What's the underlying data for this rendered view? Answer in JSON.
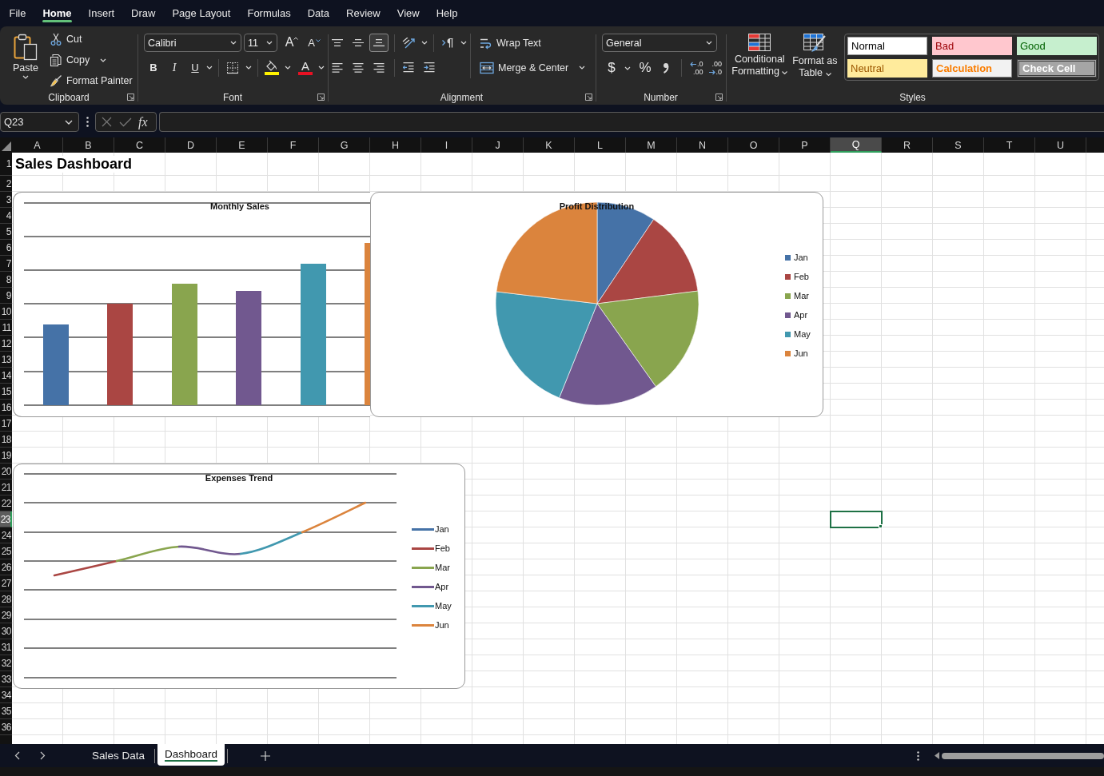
{
  "menu": [
    {
      "label": "File",
      "selected": false
    },
    {
      "label": "Home",
      "selected": true
    },
    {
      "label": "Insert",
      "selected": false
    },
    {
      "label": "Draw",
      "selected": false
    },
    {
      "label": "Page Layout",
      "selected": false
    },
    {
      "label": "Formulas",
      "selected": false
    },
    {
      "label": "Data",
      "selected": false
    },
    {
      "label": "Review",
      "selected": false
    },
    {
      "label": "View",
      "selected": false
    },
    {
      "label": "Help",
      "selected": false
    }
  ],
  "ribbon": {
    "clipboard": {
      "paste": "Paste",
      "cut": "Cut",
      "copy": "Copy",
      "format_painter": "Format Painter",
      "label": "Clipboard"
    },
    "font": {
      "name": "Calibri",
      "size": "11",
      "grow": "A",
      "shrink": "A",
      "bold": "B",
      "italic": "I",
      "underline": "U",
      "font_color": "A",
      "label": "Font"
    },
    "alignment": {
      "vertical": [
        {
          "selected": false
        },
        {
          "selected": false
        },
        {
          "selected": true
        }
      ],
      "wrap_text": "Wrap Text",
      "merge": "Merge & Center",
      "label": "Alignment"
    },
    "number": {
      "format": "General",
      "currency": "$",
      "percent": "%",
      "increase_decimal": {
        "top": ".0",
        "bottom": ".00"
      },
      "decrease_decimal": {
        "top": ".00",
        "bottom": ".0"
      },
      "label": "Number"
    },
    "styles": {
      "conditional_formatting": "Conditional Formatting",
      "format_as_table": "Format as Table",
      "gallery": [
        {
          "label": "Normal",
          "kind": "normal"
        },
        {
          "label": "Bad",
          "kind": "bad"
        },
        {
          "label": "Good",
          "kind": "good"
        },
        {
          "label": "Neutral",
          "kind": "neutral"
        },
        {
          "label": "Calculation",
          "kind": "calculation"
        },
        {
          "label": "Check Cell",
          "kind": "check"
        }
      ],
      "label": "Styles"
    }
  },
  "formula_bar": {
    "name_box": "Q23",
    "function_label": "fx"
  },
  "sheet": {
    "title": "Sales Dashboard",
    "columns": [
      {
        "label": "A",
        "selected": false
      },
      {
        "label": "B",
        "selected": false
      },
      {
        "label": "C",
        "selected": false
      },
      {
        "label": "D",
        "selected": false
      },
      {
        "label": "E",
        "selected": false
      },
      {
        "label": "F",
        "selected": false
      },
      {
        "label": "G",
        "selected": false
      },
      {
        "label": "H",
        "selected": false
      },
      {
        "label": "I",
        "selected": false
      },
      {
        "label": "J",
        "selected": false
      },
      {
        "label": "K",
        "selected": false
      },
      {
        "label": "L",
        "selected": false
      },
      {
        "label": "M",
        "selected": false
      },
      {
        "label": "N",
        "selected": false
      },
      {
        "label": "O",
        "selected": false
      },
      {
        "label": "P",
        "selected": false
      },
      {
        "label": "Q",
        "selected": true
      },
      {
        "label": "R",
        "selected": false
      },
      {
        "label": "S",
        "selected": false
      },
      {
        "label": "T",
        "selected": false
      },
      {
        "label": "U",
        "selected": false
      }
    ],
    "rows": [
      {
        "label": "1",
        "selected": false
      },
      {
        "label": "2",
        "selected": false
      },
      {
        "label": "3",
        "selected": false
      },
      {
        "label": "4",
        "selected": false
      },
      {
        "label": "5",
        "selected": false
      },
      {
        "label": "6",
        "selected": false
      },
      {
        "label": "7",
        "selected": false
      },
      {
        "label": "8",
        "selected": false
      },
      {
        "label": "9",
        "selected": false
      },
      {
        "label": "10",
        "selected": false
      },
      {
        "label": "11",
        "selected": false
      },
      {
        "label": "12",
        "selected": false
      },
      {
        "label": "13",
        "selected": false
      },
      {
        "label": "14",
        "selected": false
      },
      {
        "label": "15",
        "selected": false
      },
      {
        "label": "16",
        "selected": false
      },
      {
        "label": "17",
        "selected": false
      },
      {
        "label": "18",
        "selected": false
      },
      {
        "label": "19",
        "selected": false
      },
      {
        "label": "20",
        "selected": false
      },
      {
        "label": "21",
        "selected": false
      },
      {
        "label": "22",
        "selected": false
      },
      {
        "label": "23",
        "selected": true
      },
      {
        "label": "24",
        "selected": false
      },
      {
        "label": "25",
        "selected": false
      },
      {
        "label": "26",
        "selected": false
      },
      {
        "label": "27",
        "selected": false
      },
      {
        "label": "28",
        "selected": false
      },
      {
        "label": "29",
        "selected": false
      },
      {
        "label": "30",
        "selected": false
      },
      {
        "label": "31",
        "selected": false
      },
      {
        "label": "32",
        "selected": false
      },
      {
        "label": "33",
        "selected": false
      },
      {
        "label": "34",
        "selected": false
      },
      {
        "label": "35",
        "selected": false
      },
      {
        "label": "36",
        "selected": false
      }
    ]
  },
  "charts": [
    {
      "kind": "bar",
      "title": "Monthly Sales"
    },
    {
      "kind": "pie",
      "title": "Profit Distribution",
      "legend": [
        {
          "label": "Jan",
          "color": "#4572a7"
        },
        {
          "label": "Feb",
          "color": "#aa4643"
        },
        {
          "label": "Mar",
          "color": "#89a54e"
        },
        {
          "label": "Apr",
          "color": "#71588f"
        },
        {
          "label": "May",
          "color": "#4198af"
        },
        {
          "label": "Jun",
          "color": "#db843d"
        }
      ]
    },
    {
      "kind": "line",
      "title": "Expenses Trend",
      "legend": [
        {
          "label": "Jan",
          "color": "#4572a7"
        },
        {
          "label": "Feb",
          "color": "#aa4643"
        },
        {
          "label": "Mar",
          "color": "#89a54e"
        },
        {
          "label": "Apr",
          "color": "#71588f"
        },
        {
          "label": "May",
          "color": "#4198af"
        },
        {
          "label": "Jun",
          "color": "#db843d"
        }
      ]
    }
  ],
  "sheet_tabs": [
    {
      "label": "Sales Data",
      "selected": false
    },
    {
      "label": "Dashboard",
      "selected": true
    }
  ]
}
